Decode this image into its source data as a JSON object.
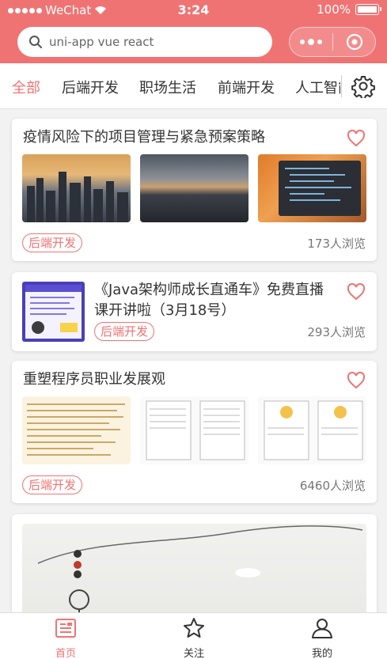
{
  "status": {
    "carrier": "WeChat",
    "time": "3:24",
    "battery": "100%"
  },
  "search": {
    "placeholder": "uni-app vue react"
  },
  "tabs": [
    "全部",
    "后端开发",
    "职场生活",
    "前端开发",
    "人工智能"
  ],
  "cards": [
    {
      "title": "疫情风险下的项目管理与紧急预案策略",
      "tag": "后端开发",
      "views": "173人浏览"
    },
    {
      "title": "《Java架构师成长直通车》免费直播课开讲啦（3月18号）",
      "tag": "后端开发",
      "views": "293人浏览"
    },
    {
      "title": "重塑程序员职业发展观",
      "tag": "后端开发",
      "views": "6460人浏览"
    }
  ],
  "tabbar": [
    {
      "label": "首页",
      "icon": "home-icon"
    },
    {
      "label": "关注",
      "icon": "star-icon"
    },
    {
      "label": "我的",
      "icon": "user-icon"
    }
  ],
  "colors": {
    "accent": "#f07373"
  }
}
